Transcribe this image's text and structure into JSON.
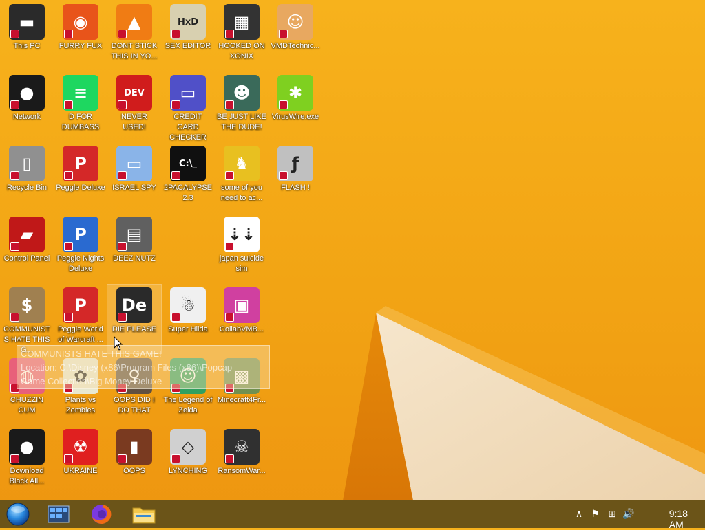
{
  "desktop": {
    "icons": [
      {
        "label": "This PC",
        "glyph": "▬",
        "color": "#2a2a2a",
        "icon": "monitor-icon"
      },
      {
        "label": "FURRY FUX",
        "glyph": "◉",
        "color": "#e8541a",
        "icon": "firefox-icon"
      },
      {
        "label": "DONT STICK THIS IN YO...",
        "glyph": "▲",
        "color": "#f07c14",
        "icon": "traffic-cone-icon"
      },
      {
        "label": "SEX EDITOR",
        "glyph": "HxD",
        "color": "#d8d0b0",
        "icon": "hex-editor-icon"
      },
      {
        "label": "HOOKED ON XONIX",
        "glyph": "▦",
        "color": "#333333",
        "icon": "xonix-icon"
      },
      {
        "label": "VMDTechnic...",
        "glyph": "☺",
        "color": "#e8a860",
        "icon": "doctor-icon"
      },
      {
        "label": "Network",
        "glyph": "●",
        "color": "#1a1a1a",
        "icon": "network-icon"
      },
      {
        "label": "D FOR DUMBASS",
        "glyph": "≡",
        "color": "#1ed760",
        "icon": "message-icon"
      },
      {
        "label": "NEVER USED!",
        "glyph": "DEV",
        "color": "#d01c1c",
        "icon": "devcpp-icon"
      },
      {
        "label": "CREDIT CARD CHECKER",
        "glyph": "▭",
        "color": "#5050c8",
        "icon": "credit-card-icon"
      },
      {
        "label": "BE JUST LIKE THE DUDE!",
        "glyph": "☻",
        "color": "#3a6a5a",
        "icon": "dude-icon"
      },
      {
        "label": "VirusWire.exe",
        "glyph": "✱",
        "color": "#7fd020",
        "icon": "lime-icon"
      },
      {
        "label": "Recycle Bin",
        "glyph": "▯",
        "color": "#909090",
        "icon": "recycle-bin-icon"
      },
      {
        "label": "Peggle Deluxe",
        "glyph": "P",
        "color": "#d42828",
        "icon": "peggle-icon"
      },
      {
        "label": "ISRAEL SPY",
        "glyph": "▭",
        "color": "#8ab4e8",
        "icon": "network-computer-icon"
      },
      {
        "label": "2PACALYPSE 2.3",
        "glyph": "C:\\_",
        "color": "#101010",
        "icon": "console-icon"
      },
      {
        "label": "some of you need to ac...",
        "glyph": "♞",
        "color": "#e8c020",
        "icon": "dog-icon"
      },
      {
        "label": "FLASH !",
        "glyph": "ƒ",
        "color": "#c0c0c0",
        "icon": "flash-icon"
      },
      {
        "label": "Control Panel",
        "glyph": "▰",
        "color": "#c01818",
        "icon": "control-panel-icon"
      },
      {
        "label": "Peggle Nights Deluxe",
        "glyph": "P",
        "color": "#2a6ad0",
        "icon": "peggle-nights-icon"
      },
      {
        "label": "DEEZ NUTZ",
        "glyph": "▤",
        "color": "#606060",
        "icon": "stack-icon"
      },
      {
        "label": "japan suicide sim",
        "glyph": "⇣⇣",
        "color": "#ffffff",
        "icon": "sim-icon"
      },
      {
        "label": "COMMUNISTS HATE THIS G...",
        "glyph": "$",
        "color": "#a08050",
        "icon": "money-bag-icon"
      },
      {
        "label": "Peggle World of Warcraft ...",
        "glyph": "P",
        "color": "#d42828",
        "icon": "peggle-wow-icon"
      },
      {
        "label": "DIE PLEASE",
        "glyph": "De",
        "color": "#2a2a2a",
        "icon": "de-icon"
      },
      {
        "label": "Super Hilda",
        "glyph": "☃",
        "color": "#f0f0f0",
        "icon": "hilda-icon"
      },
      {
        "label": "CollabVMB...",
        "glyph": "▣",
        "color": "#d040a0",
        "icon": "monitor-pink-icon"
      },
      {
        "label": "CHUZZIN CUM",
        "glyph": "◍",
        "color": "#e8607a",
        "icon": "chuzzle-icon"
      },
      {
        "label": "Plants vs Zombies",
        "glyph": "✿",
        "color": "#e8e8d0",
        "icon": "pvz-icon"
      },
      {
        "label": "OOPS DID I DO THAT",
        "glyph": "♀",
        "color": "#605040",
        "icon": "portrait-icon"
      },
      {
        "label": "The Legend of Zelda",
        "glyph": "☺",
        "color": "#30a060",
        "icon": "zelda-icon"
      },
      {
        "label": "Minecraft4Fr...",
        "glyph": "▩",
        "color": "#709050",
        "icon": "minecraft-icon"
      },
      {
        "label": "Download Black All...",
        "glyph": "●",
        "color": "#1a1a1a",
        "icon": "download-icon"
      },
      {
        "label": "UKRAINE",
        "glyph": "☢",
        "color": "#e02020",
        "icon": "radiation-icon"
      },
      {
        "label": "OOPS",
        "glyph": "▮",
        "color": "#7a3a20",
        "icon": "book-icon"
      },
      {
        "label": "LYNCHING",
        "glyph": "◇",
        "color": "#d0d0d0",
        "icon": "rope-icon"
      },
      {
        "label": "RansomWar...",
        "glyph": "☠",
        "color": "#303030",
        "icon": "skull-icon"
      }
    ]
  },
  "tooltip": {
    "line1": "COMMUNISTS HATE THIS GAME!",
    "line2": "Location: C:\\Disney (x86\\Program Files (x86)\\Popcap",
    "line3": "Game Collection\\Big Money Deluxe"
  },
  "taskbar": {
    "start": "start-orb",
    "pinned": [
      {
        "name": "task-view",
        "icon": "windows-explorer-panel-icon"
      },
      {
        "name": "firefox",
        "icon": "firefox-icon"
      },
      {
        "name": "file-explorer",
        "icon": "folder-icon"
      }
    ],
    "tray": {
      "overflow_symbol": "∧",
      "flag_symbol": "⚑",
      "network_symbol": "⊞",
      "volume_symbol": "🔊",
      "clock": "9:18 AM"
    }
  },
  "colors": {
    "wallpaper": "#f2a414",
    "taskbar": "#6b5418",
    "accent_shortcut": "#c8102e"
  }
}
